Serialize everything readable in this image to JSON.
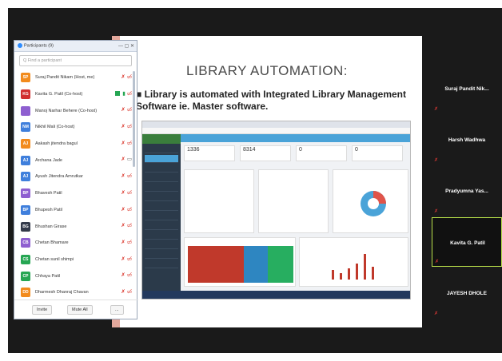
{
  "participants_panel": {
    "title": "Participants (9)",
    "window_controls": "— ▢ ✕",
    "search_placeholder": "Q Find a participant",
    "list": [
      {
        "initials": "SP",
        "name": "Suraj Pandit Nikam (Host, me)",
        "color": "#f28b1d",
        "mic": "off",
        "cam": "off"
      },
      {
        "initials": "KG",
        "name": "Kavita G. Patil (Co-host)",
        "color": "#d12f2f",
        "mic": "on",
        "cam": "off",
        "sharing": true
      },
      {
        "initials": "",
        "name": "Manoj Narhar Behere (Co-host)",
        "color": "#8e5fd0",
        "mic": "off",
        "cam": "off"
      },
      {
        "initials": "NM",
        "name": "Nikhil Mali (Co-host)",
        "color": "#3f7fdc",
        "mic": "off",
        "cam": "off"
      },
      {
        "initials": "AJ",
        "name": "Aakash jitendra bagul",
        "color": "#f28b1d",
        "mic": "off",
        "cam": "off"
      },
      {
        "initials": "AJ",
        "name": "Archana Jade",
        "color": "#3f7fdc",
        "mic": "off",
        "cam": "on"
      },
      {
        "initials": "AJ",
        "name": "Ayush Jitendra Amrutkar",
        "color": "#3f7fdc",
        "mic": "off",
        "cam": "off"
      },
      {
        "initials": "BP",
        "name": "Bhavesh Patil",
        "color": "#8e5fd0",
        "mic": "off",
        "cam": "off"
      },
      {
        "initials": "BP",
        "name": "Bhupesh Patil",
        "color": "#3f7fdc",
        "mic": "off",
        "cam": "off"
      },
      {
        "initials": "BG",
        "name": "Bhushan Girase",
        "color": "#333a4a",
        "mic": "off",
        "cam": "off"
      },
      {
        "initials": "CB",
        "name": "Chetan Bhamare",
        "color": "#8e5fd0",
        "mic": "off",
        "cam": "off"
      },
      {
        "initials": "CS",
        "name": "Chetan sunil shimpi",
        "color": "#26a653",
        "mic": "off",
        "cam": "off"
      },
      {
        "initials": "CP",
        "name": "Chhaya Patil",
        "color": "#26a653",
        "mic": "off",
        "cam": "off"
      },
      {
        "initials": "DD",
        "name": "Dharmesh Dhanraj Chavan",
        "color": "#f28b1d",
        "mic": "off",
        "cam": "off"
      }
    ],
    "invite_label": "Invite",
    "mute_all_label": "Mute All",
    "more_label": "..."
  },
  "slide": {
    "title": "LIBRARY AUTOMATION:",
    "text": "Library is automated with Integrated Library Management Software ie. Master software."
  },
  "video_tiles": [
    {
      "name": "Suraj Pandit Nik...",
      "active": false
    },
    {
      "name": "Harsh Wadhwa",
      "active": false
    },
    {
      "name": "Pradyumna Yas...",
      "active": false
    },
    {
      "name": "Kavita G. Patil",
      "active": true
    },
    {
      "name": "JAYESH DHOLE",
      "active": false
    }
  ],
  "embedded_app": {
    "stats": [
      "1336",
      "8314",
      "0",
      "0"
    ]
  }
}
